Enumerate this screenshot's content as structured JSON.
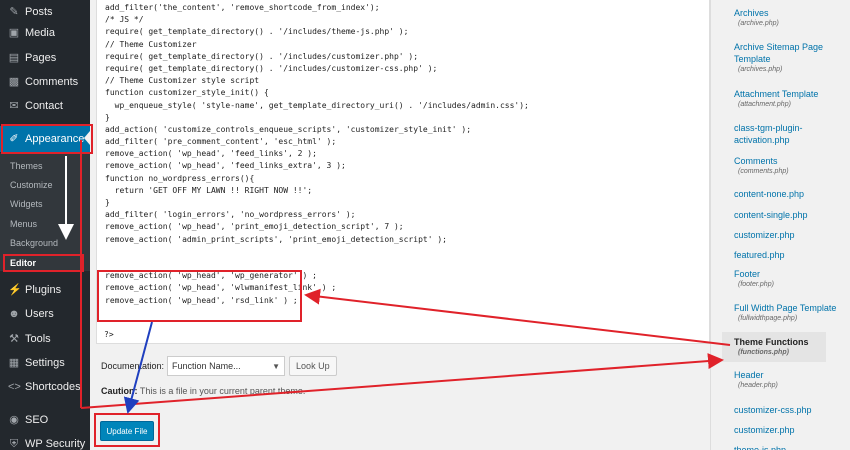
{
  "sidebar": {
    "menu": [
      {
        "label": "Posts",
        "icon": "pin-icon"
      },
      {
        "label": "Media",
        "icon": "media-icon"
      },
      {
        "label": "Pages",
        "icon": "pages-icon"
      },
      {
        "label": "Comments",
        "icon": "comments-icon"
      },
      {
        "label": "Contact",
        "icon": "mail-icon"
      },
      {
        "label": "Appearance",
        "icon": "brush-icon"
      }
    ],
    "submenu": [
      "Themes",
      "Customize",
      "Widgets",
      "Menus",
      "Background",
      "Editor"
    ],
    "menu_lower": [
      {
        "label": "Plugins",
        "icon": "plug-icon"
      },
      {
        "label": "Users",
        "icon": "users-icon"
      },
      {
        "label": "Tools",
        "icon": "wrench-icon"
      },
      {
        "label": "Settings",
        "icon": "settings-icon"
      },
      {
        "label": "Shortcodes",
        "icon": "code-icon"
      },
      {
        "label": "SEO",
        "icon": "seo-icon"
      },
      {
        "label": "WP Security",
        "icon": "shield-icon"
      }
    ]
  },
  "editor": {
    "lines": [
      "add_filter('the_content', 'remove_shortcode_from_index');",
      "/* JS */",
      "require( get_template_directory() . '/includes/theme-js.php' );",
      "// Theme Customizer",
      "require( get_template_directory() . '/includes/customizer.php' );",
      "require( get_template_directory() . '/includes/customizer-css.php' );",
      "// Theme Customizer style script",
      "function customizer_style_init() {",
      "  wp_enqueue_style( 'style-name', get_template_directory_uri() . '/includes/admin.css');",
      "}",
      "add_action( 'customize_controls_enqueue_scripts', 'customizer_style_init' );",
      "add_filter( 'pre_comment_content', 'esc_html' );",
      "remove_action( 'wp_head', 'feed_links', 2 );",
      "remove_action( 'wp_head', 'feed_links_extra', 3 );",
      "function no_wordpress_errors(){",
      "  return 'GET OFF MY LAWN !! RIGHT NOW !!';",
      "}",
      "add_filter( 'login_errors', 'no_wordpress_errors' );",
      "remove_action( 'wp_head', 'print_emoji_detection_script', 7 );",
      "remove_action( 'admin_print_scripts', 'print_emoji_detection_script' );",
      "",
      "",
      "remove_action( 'wp_head', 'wp_generator' ) ;",
      "remove_action( 'wp_head', 'wlwmanifest_link' ) ;",
      "remove_action( 'wp_head', 'rsd_link' ) ;"
    ],
    "end_tag": "?>"
  },
  "documentation": {
    "label": "Documentation:",
    "select_value": "Function Name...",
    "lookup_label": "Look Up"
  },
  "caution": {
    "label": "Caution:",
    "text": " This is a file in your current parent theme."
  },
  "update_button": "Update File",
  "files": [
    {
      "name": "Archives",
      "sub": "(archive.php)"
    },
    {
      "name": "Archive Sitemap Page Template",
      "sub": "(archives.php)"
    },
    {
      "name": "Attachment Template",
      "sub": "(attachment.php)"
    },
    {
      "name": "class-tgm-plugin-activation.php",
      "sub": ""
    },
    {
      "name": "Comments",
      "sub": "(comments.php)"
    },
    {
      "name": "content-none.php",
      "sub": ""
    },
    {
      "name": "content-single.php",
      "sub": ""
    },
    {
      "name": "customizer.php",
      "sub": ""
    },
    {
      "name": "featured.php",
      "sub": ""
    },
    {
      "name": "Footer",
      "sub": "(footer.php)"
    },
    {
      "name": "Full Width Page Template",
      "sub": "(fullwidthpage.php)"
    },
    {
      "name": "Theme Functions",
      "sub": "(functions.php)"
    },
    {
      "name": "Header",
      "sub": "(header.php)"
    },
    {
      "name": "customizer-css.php",
      "sub": ""
    },
    {
      "name": "customizer.php",
      "sub": ""
    },
    {
      "name": "theme-js.php",
      "sub": ""
    }
  ],
  "colors": {
    "sidebar_bg": "#23282d",
    "accent": "#0073aa",
    "annotation_red": "#e0222a",
    "annotation_blue": "#1f3fbf"
  }
}
